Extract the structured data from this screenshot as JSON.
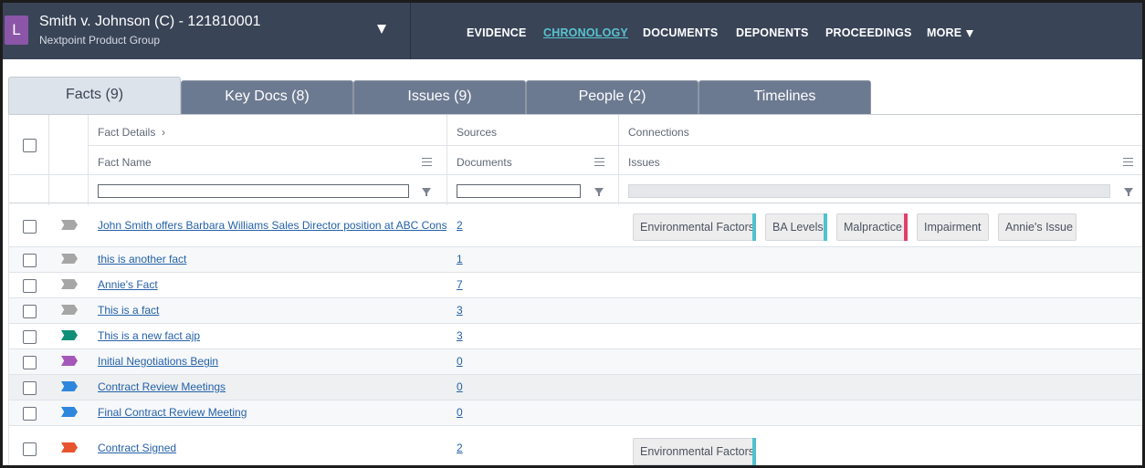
{
  "header": {
    "case_initial": "L",
    "case_title": "Smith v. Johnson (C) - 121810001",
    "case_subtitle": "Nextpoint Product Group",
    "nav": [
      "EVIDENCE",
      "CHRONOLOGY",
      "DOCUMENTS",
      "DEPONENTS",
      "PROCEEDINGS",
      "MORE"
    ],
    "active_nav": "CHRONOLOGY"
  },
  "tabs": [
    {
      "label": "Facts (9)",
      "active": true
    },
    {
      "label": "Key Docs (8)",
      "active": false
    },
    {
      "label": "Issues (9)",
      "active": false
    },
    {
      "label": "People (2)",
      "active": false
    },
    {
      "label": "Timelines",
      "active": false
    }
  ],
  "grid": {
    "group_headers": {
      "fact_details": "Fact Details",
      "fact_details_chevron": "›",
      "sources": "Sources",
      "connections": "Connections"
    },
    "columns": {
      "fact_name": "Fact Name",
      "documents": "Documents",
      "issues": "Issues"
    },
    "rows": [
      {
        "flag_color": "#a6a6a6",
        "fact": "John Smith offers Barbara Williams Sales Director position at ABC Construction",
        "docs": "2",
        "issues": [
          {
            "label": "Environmental Factors",
            "color": "#4fc1cf"
          },
          {
            "label": "BA Levels",
            "color": "#4fc1cf"
          },
          {
            "label": "Malpractice",
            "color": "#e0406a"
          },
          {
            "label": "Impairment",
            "color": ""
          },
          {
            "label": "Annie's Issue",
            "color": ""
          }
        ]
      },
      {
        "flag_color": "#a6a6a6",
        "fact": "this is another fact",
        "docs": "1",
        "issues": []
      },
      {
        "flag_color": "#a6a6a6",
        "fact": "Annie's Fact",
        "docs": "7",
        "issues": []
      },
      {
        "flag_color": "#a6a6a6",
        "fact": "This is a fact",
        "docs": "3",
        "issues": []
      },
      {
        "flag_color": "#0f8f78",
        "fact": "This is a new fact ajp",
        "docs": "3",
        "issues": []
      },
      {
        "flag_color": "#a558b8",
        "fact": "Initial Negotiations Begin",
        "docs": "0",
        "issues": []
      },
      {
        "flag_color": "#2f86dd",
        "fact": "Contract Review Meetings",
        "docs": "0",
        "issues": [],
        "highlight": true
      },
      {
        "flag_color": "#2f86dd",
        "fact": "Final Contract Review Meeting",
        "docs": "0",
        "issues": []
      },
      {
        "flag_color": "#e8532d",
        "fact": "Contract Signed",
        "docs": "2",
        "issues": [
          {
            "label": "Environmental Factors",
            "color": "#4fc1cf"
          }
        ]
      }
    ]
  }
}
